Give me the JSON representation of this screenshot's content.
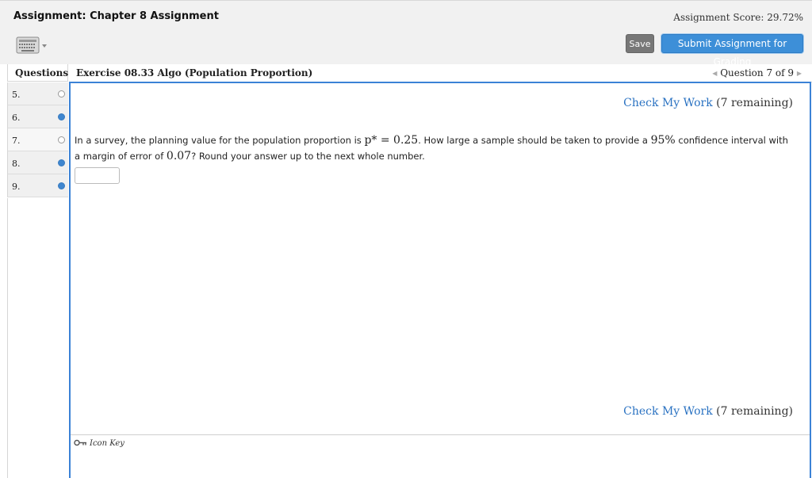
{
  "header": {
    "title": "Assignment: Chapter 8 Assignment",
    "score": "Assignment Score: 29.72%",
    "save_label": "Save",
    "submit_label": "Submit Assignment for Grading",
    "keyboard_icon": "keyboard-icon"
  },
  "sidebar": {
    "heading": "Questions",
    "items": [
      {
        "num": "5.",
        "status": "empty"
      },
      {
        "num": "6.",
        "status": "filled"
      },
      {
        "num": "7.",
        "status": "empty"
      },
      {
        "num": "8.",
        "status": "filled"
      },
      {
        "num": "9.",
        "status": "filled"
      }
    ]
  },
  "exercise": {
    "title": "Exercise 08.33 Algo (Population Proportion)",
    "nav": "Question 7 of 9",
    "check_link": "Check My Work",
    "remaining": "(7 remaining)",
    "question": {
      "p1": "In a survey, the planning value for the population proportion is ",
      "m1": "p* = 0.25",
      "p2": ". How large a sample should be taken to provide a ",
      "m2": "95%",
      "p3": " confidence interval with a margin of error of ",
      "m3": "0.07",
      "p4": "? Round your answer up to the next whole number."
    },
    "answer_value": "",
    "icon_key": "Icon Key"
  },
  "colors": {
    "accent": "#3b82d6",
    "submit": "#3d8fd8",
    "save": "#777777",
    "dot_filled": "#3f86cf"
  }
}
